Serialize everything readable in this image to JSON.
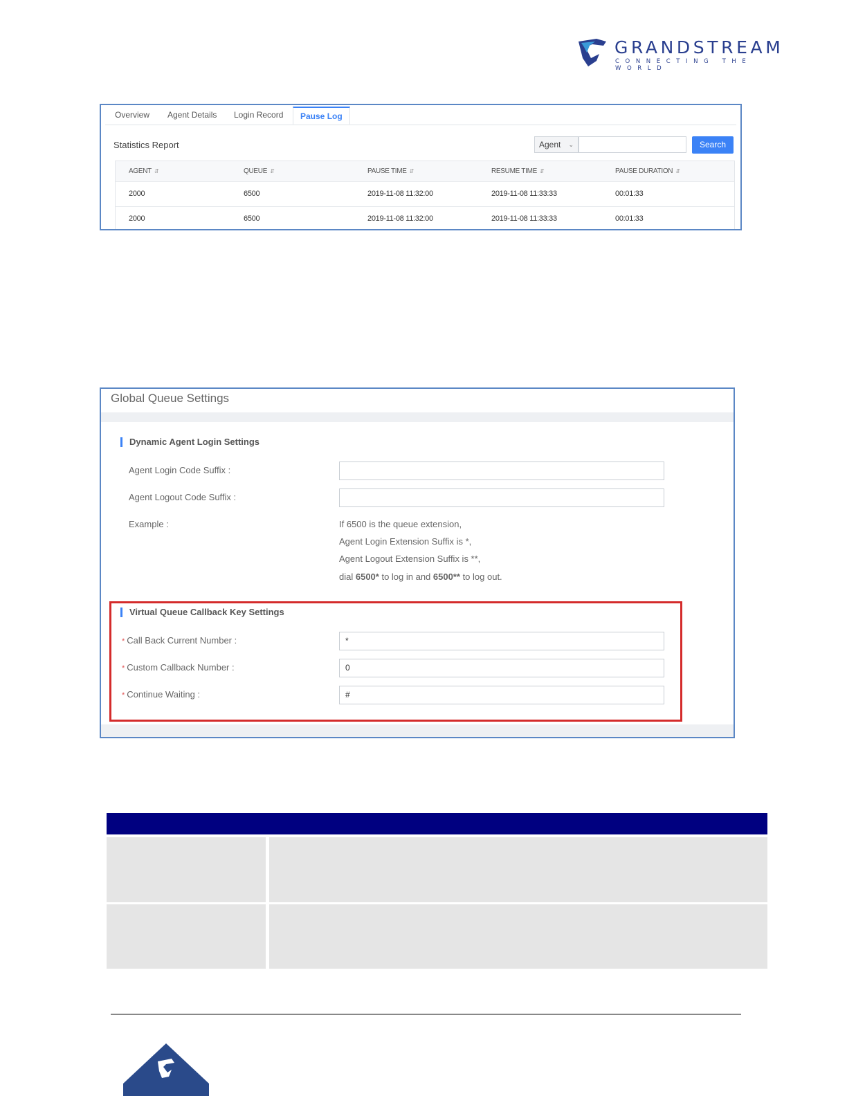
{
  "logo": {
    "name": "GRANDSTREAM",
    "tagline": "CONNECTING THE WORLD",
    "brand_color": "#2a3f8f"
  },
  "pause_log": {
    "tabs": [
      "Overview",
      "Agent Details",
      "Login Record",
      "Pause Log"
    ],
    "active_tab": "Pause Log",
    "report_title": "Statistics Report",
    "filter": {
      "selected": "Agent",
      "placeholder": ""
    },
    "search_button": "Search",
    "columns": [
      "AGENT",
      "QUEUE",
      "PAUSE TIME",
      "RESUME TIME",
      "PAUSE DURATION"
    ],
    "rows": [
      [
        "2000",
        "6500",
        "2019-11-08 11:32:00",
        "2019-11-08 11:33:33",
        "00:01:33"
      ],
      [
        "2000",
        "6500",
        "2019-11-08 11:32:00",
        "2019-11-08 11:33:33",
        "00:01:33"
      ]
    ]
  },
  "global_queue": {
    "title": "Global Queue Settings",
    "dynamic_section": "Dynamic Agent Login Settings",
    "login_suffix_label": "Agent Login Code Suffix :",
    "logout_suffix_label": "Agent Logout Code Suffix :",
    "login_suffix_value": "",
    "logout_suffix_value": "",
    "example_label": "Example :",
    "example_lines": {
      "l1": "If 6500 is the queue extension,",
      "l2": "Agent Login Extension Suffix is *,",
      "l3": "Agent Logout Extension Suffix is **,",
      "l4_a": "dial ",
      "l4_b": "6500*",
      "l4_c": " to log in and ",
      "l4_d": "6500**",
      "l4_e": " to log out."
    },
    "callback_section": "Virtual Queue Callback Key Settings",
    "callback_fields": [
      {
        "label": "Call Back Current Number :",
        "value": "*"
      },
      {
        "label": "Custom Callback Number :",
        "value": "0"
      },
      {
        "label": "Continue Waiting :",
        "value": "#"
      }
    ]
  },
  "colors": {
    "accent": "#3b82f6",
    "header_band": "#000080",
    "highlight": "#d42b2b"
  }
}
